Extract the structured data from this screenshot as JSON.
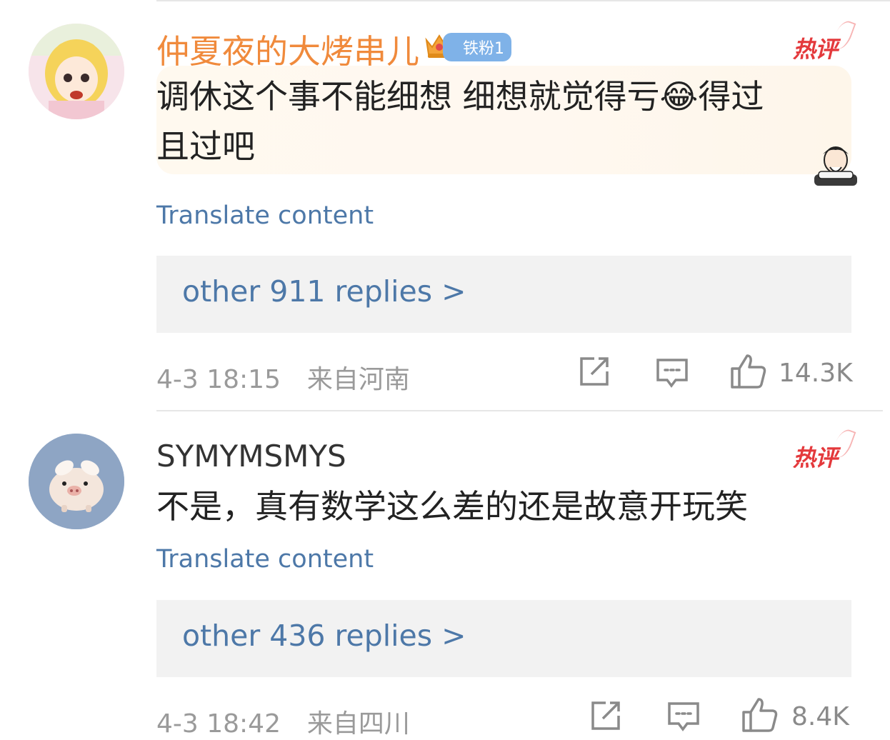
{
  "comments": [
    {
      "username": "仲夏夜的大烤串儿",
      "fan_badge": "铁粉1",
      "hot_label": "热评",
      "text": "调休这个事不能细想  细想就觉得亏😂得过且过吧",
      "text_line1": "调休这个事不能细想  细想就觉得亏",
      "emoji": "😂",
      "text_line1_tail": "得过",
      "text_line2": "且过吧",
      "translate_label": "Translate content",
      "replies_label": "other 911 replies >",
      "time": "4-3 18:15",
      "location": "来自河南",
      "like_count": "14.3K"
    },
    {
      "username": "SYMYMSMYS",
      "hot_label": "热评",
      "text": "不是，真有数学这么差的还是故意开玩笑",
      "translate_label": "Translate content",
      "replies_label": "other 436 replies >",
      "time": "4-3 18:42",
      "location": "来自四川",
      "like_count": "8.4K"
    }
  ],
  "icons": {
    "share": "share-icon",
    "comment": "comment-icon",
    "like": "thumbs-up-icon"
  },
  "colors": {
    "username_highlight": "#f08a3c",
    "link_blue": "#4d78a8",
    "hot_red": "#e4393c",
    "meta_gray": "#9a9a9a"
  }
}
